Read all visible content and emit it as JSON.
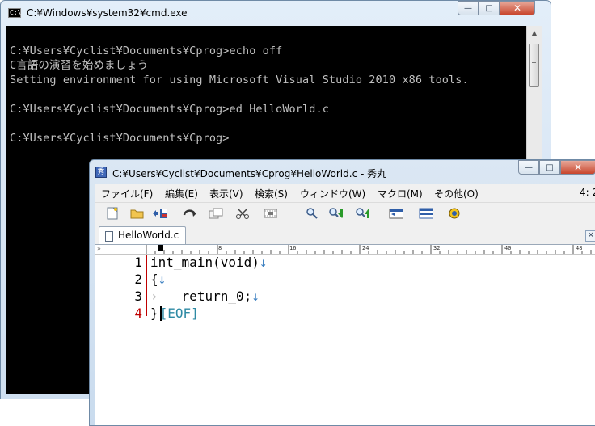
{
  "cmd": {
    "title": "C:¥Windows¥system32¥cmd.exe",
    "icon_text": "C:\\",
    "buttons": {
      "min": "—",
      "max": "□",
      "close": "✕"
    },
    "lines": [
      "",
      "C:¥Users¥Cyclist¥Documents¥Cprog>echo off",
      "C言語の演習を始めましょう",
      "Setting environment for using Microsoft Visual Studio 2010 x86 tools.",
      "",
      "C:¥Users¥Cyclist¥Documents¥Cprog>ed HelloWorld.c",
      "",
      "C:¥Users¥Cyclist¥Documents¥Cprog>"
    ]
  },
  "editor": {
    "title": "C:¥Users¥Cyclist¥Documents¥Cprog¥HelloWorld.c - 秀丸",
    "buttons": {
      "min": "—",
      "max": "□",
      "close": "✕"
    },
    "menu": [
      "ファイル(F)",
      "編集(E)",
      "表示(V)",
      "検索(S)",
      "ウィンドウ(W)",
      "マクロ(M)",
      "その他(O)"
    ],
    "cursor_position": "4: 2",
    "tab": {
      "label": "HelloWorld.c",
      "close": "✕"
    },
    "ruler": {
      "marker": "»",
      "numbers": [
        "8",
        "16",
        "24",
        "32",
        "40",
        "48"
      ]
    },
    "line_numbers": [
      "1",
      "2",
      "3",
      "4"
    ],
    "code": {
      "line1_a": "int",
      "line1_b": "main(void)",
      "line2": "{",
      "tab_mark": "›",
      "line3_a": "return",
      "line3_b": "0;",
      "line4": "}",
      "newline_mark": "↓",
      "eof": "[EOF]"
    }
  }
}
